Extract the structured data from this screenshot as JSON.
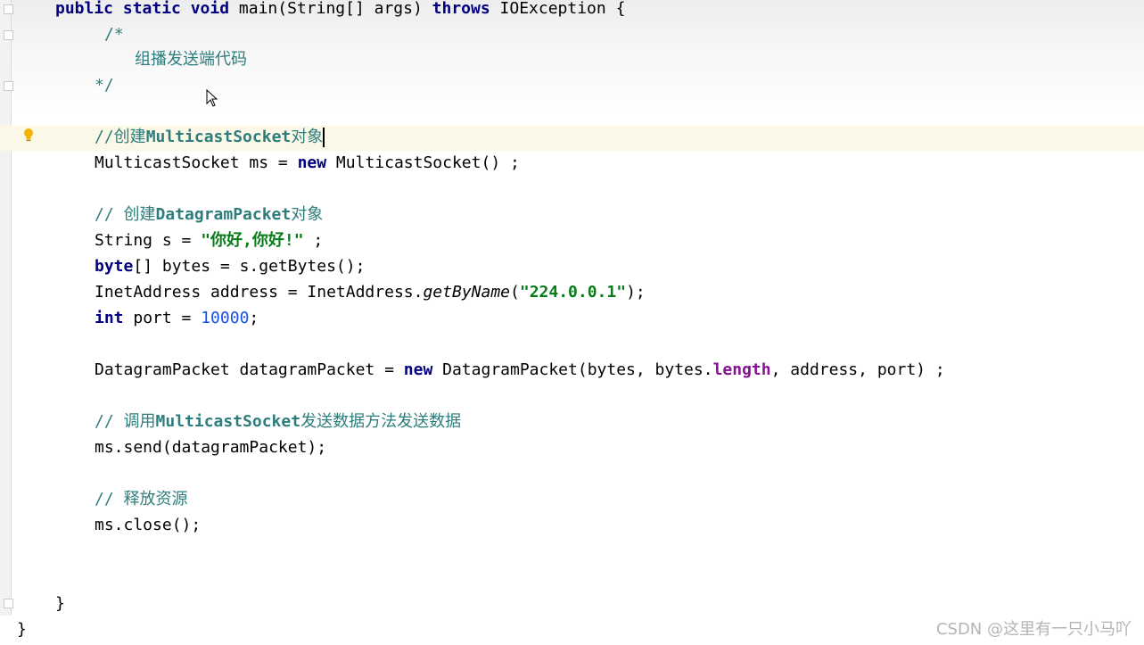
{
  "editor": {
    "lines": [
      {
        "kw1": "public static void",
        "plain1": " main(String[] args) ",
        "kw2": "throws",
        "plain2": " IOException {"
      },
      {
        "comment": "/*"
      },
      {
        "comment": "组播发送端代码"
      },
      {
        "comment": "*/"
      },
      {
        "comment_prefix": "//创建",
        "comment_bold": "MulticastSocket",
        "comment_suffix": "对象"
      },
      {
        "plain1": "MulticastSocket ms = ",
        "kw1": "new",
        "plain2": " MulticastSocket() ;"
      },
      {
        "comment_prefix": "// 创建",
        "comment_bold": "DatagramPacket",
        "comment_suffix": "对象"
      },
      {
        "plain1": "String s = ",
        "str": "\"你好,你好!\"",
        "plain2": " ;"
      },
      {
        "kw1": "byte",
        "plain1": "[] bytes = s.getBytes();"
      },
      {
        "plain1": "InetAddress address = InetAddress.",
        "italic": "getByName",
        "plain2": "(",
        "str": "\"224.0.0.1\"",
        "plain3": ");"
      },
      {
        "kw1": "int",
        "plain1": " port = ",
        "num": "10000",
        "plain2": ";"
      },
      {
        "plain1": "DatagramPacket datagramPacket = ",
        "kw1": "new",
        "plain2": " DatagramPacket(bytes, bytes.",
        "field": "length",
        "plain3": ", address, port) ;"
      },
      {
        "comment_prefix": "// 调用",
        "comment_bold": "MulticastSocket",
        "comment_suffix": "发送数据方法发送数据"
      },
      {
        "plain1": "ms.send(datagramPacket);"
      },
      {
        "comment_prefix": "// 释放资源"
      },
      {
        "plain1": "ms.close();"
      },
      {
        "plain1": "}"
      },
      {
        "plain1": "}"
      }
    ]
  },
  "watermark": "CSDN @这里有一只小马吖",
  "icons": {
    "bulb": "lightbulb-icon",
    "cursor": "mouse-cursor-icon",
    "fold": "fold-marker-icon"
  },
  "colors": {
    "keyword": "#000080",
    "comment": "#2e7d7d",
    "string": "#067d17",
    "number": "#1750eb",
    "field": "#871094",
    "highlight": "#fcf8e8"
  }
}
